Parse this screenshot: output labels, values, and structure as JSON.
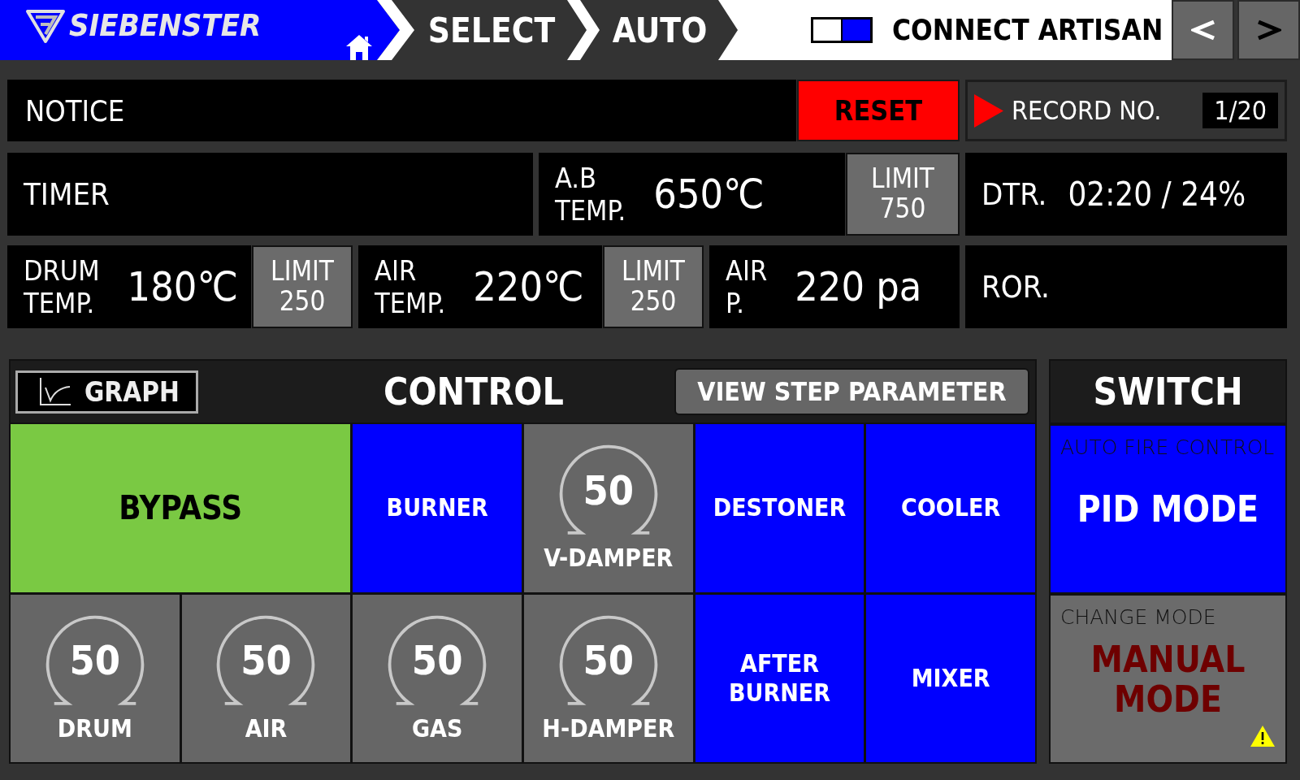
{
  "header": {
    "logo": "SIEBENSTER",
    "breadcrumbs": [
      "SELECT",
      "AUTO"
    ],
    "artisan": {
      "label": "CONNECT ARTISAN",
      "on": true
    },
    "nav_buttons": [
      {
        "kind": "previous",
        "color": "#ffffff"
      },
      {
        "kind": "next",
        "color": "#000000"
      }
    ]
  },
  "notice": {
    "label": "NOTICE",
    "reset_button": "RESET"
  },
  "record": {
    "label": "RECORD NO.",
    "value": "1/20"
  },
  "readout_rows": [
    [
      {
        "kind": "plain",
        "label": "TIMER"
      },
      {
        "kind": "measure",
        "label": "A.B TEMP.",
        "value": "650℃",
        "limit": {
          "label": "LIMIT",
          "value": "750"
        }
      },
      {
        "kind": "plain",
        "label": "DTR.",
        "value": "02:20 / 24%"
      }
    ],
    [
      {
        "kind": "measure",
        "label": "DRUM TEMP.",
        "value": "180℃",
        "limit": {
          "label": "LIMIT",
          "value": "250"
        }
      },
      {
        "kind": "measure",
        "label": "AIR TEMP.",
        "value": "220℃",
        "limit": {
          "label": "LIMIT",
          "value": "250"
        }
      },
      {
        "kind": "measure",
        "label": "AIR P.",
        "value": "220 pa"
      },
      {
        "kind": "plain",
        "label": "ROR."
      }
    ]
  ],
  "control": {
    "graph_button": "GRAPH",
    "title": "CONTROL",
    "step_button": "VIEW STEP PARAMETER",
    "tiles": [
      {
        "kind": "toggle",
        "label": "BYPASS",
        "color": "#7ac943"
      },
      {
        "kind": "toggle",
        "label": "BURNER",
        "color": "#0000ff"
      },
      {
        "kind": "dial",
        "value": "50",
        "label": "V-DAMPER"
      },
      {
        "kind": "toggle",
        "label": "DESTONER",
        "color": "#0000ff"
      },
      {
        "kind": "toggle",
        "label": "COOLER",
        "color": "#0000ff"
      },
      {
        "kind": "dial",
        "value": "50",
        "label": "DRUM"
      },
      {
        "kind": "dial",
        "value": "50",
        "label": "AIR"
      },
      {
        "kind": "dial",
        "value": "50",
        "label": "GAS"
      },
      {
        "kind": "dial",
        "value": "50",
        "label": "H-DAMPER"
      },
      {
        "kind": "toggle",
        "label": "AFTER BURNER",
        "color": "#0000ff"
      },
      {
        "kind": "toggle",
        "label": "MIXER",
        "color": "#0000ff"
      }
    ]
  },
  "switch": {
    "title": "SWITCH",
    "modes": [
      {
        "caption": "AUTO FIRE CONTROL",
        "label": "PID MODE",
        "selected": true,
        "warning": false
      },
      {
        "caption": "CHANGE MODE",
        "label": "MANUAL MODE",
        "selected": false,
        "warning": true
      }
    ]
  }
}
